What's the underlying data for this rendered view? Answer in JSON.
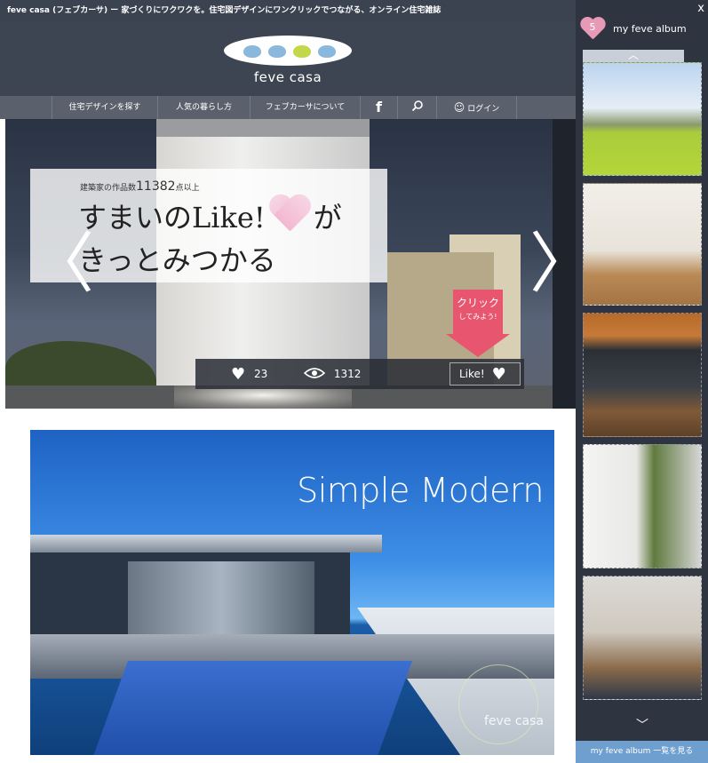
{
  "window": {
    "title": "feve casa (フェブカーサ) ー 家づくりにワクワクを。住宅図デザインにワンクリックでつながる、オンライン住宅雑誌"
  },
  "logo": {
    "text": "feve casa",
    "bean_colors": [
      "#8ab8dc",
      "#8ab8dc",
      "#c4d64a",
      "#8ab8dc"
    ]
  },
  "nav": {
    "items": [
      {
        "label": "住宅デザインを探す"
      },
      {
        "label": "人気の暮らし方"
      },
      {
        "label": "フェブカーサについて"
      },
      {
        "label": "f",
        "icon": "facebook-icon"
      },
      {
        "label": "",
        "icon": "search-icon"
      },
      {
        "label": "ログイン",
        "icon": "smiley-icon"
      }
    ]
  },
  "hero": {
    "prefix": "建築家の作品数",
    "count": "11382",
    "suffix": "点以上",
    "line1_a": "すまいのLike!",
    "line1_b": "が",
    "line2": "きっとみつかる",
    "likes": "23",
    "views": "1312",
    "like_button": "Like!",
    "click_label": "クリック",
    "click_sub": "してみよう!",
    "prev_arrow": "〈",
    "next_arrow": "〉"
  },
  "banner": {
    "title": "Simple Modern",
    "watermark": "feve casa"
  },
  "sidebar": {
    "close": "x",
    "count": "5",
    "title": "my feve album",
    "up_arrow": "︿",
    "down_arrow": "﹀",
    "footer": "my feve album 一覧を見る",
    "thumbnails": [
      {
        "name": "thumb-house-field"
      },
      {
        "name": "thumb-interior-wood"
      },
      {
        "name": "thumb-exterior-deck"
      },
      {
        "name": "thumb-stair-garden"
      },
      {
        "name": "thumb-dining"
      }
    ]
  },
  "colors": {
    "header_bg": "#3d4452",
    "nav_bg": "#5a616c",
    "sidebar_bg": "#2f3540",
    "accent_pink": "#e8556f",
    "footer_blue": "#6f9fcf"
  }
}
